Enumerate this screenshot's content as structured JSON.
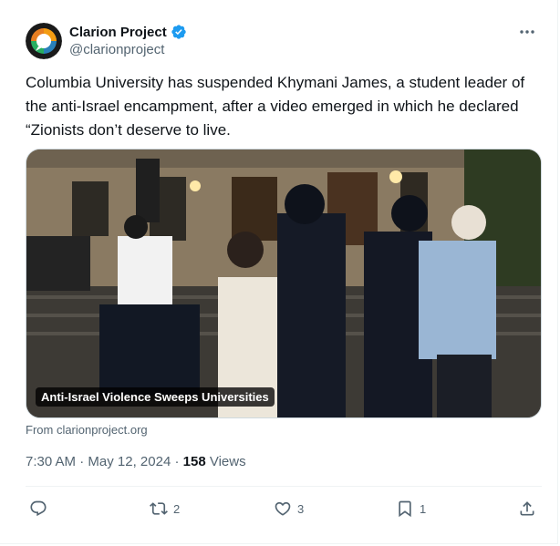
{
  "account": {
    "name": "Clarion Project",
    "handle": "@clarionproject",
    "verified_icon": "verified-badge-icon",
    "brand_color": "#1d9bf0"
  },
  "tweet": {
    "text": "Columbia University has suspended Khymani James, a student leader of the anti-Israel encampment, after a video emerged in which he declared “Zionists don’t deserve to live.",
    "media": {
      "caption": "Anti-Israel Violence Sweeps Universities",
      "source": "From clarionproject.org"
    },
    "time": "7:30 AM",
    "separator": "·",
    "date": "May 12, 2024",
    "views_count": "158",
    "views_label": "Views"
  },
  "actions": {
    "reply": {
      "icon": "reply-icon",
      "count": ""
    },
    "retweet": {
      "icon": "retweet-icon",
      "count": "2"
    },
    "like": {
      "icon": "heart-icon",
      "count": "3"
    },
    "bookmark": {
      "icon": "bookmark-icon",
      "count": "1"
    },
    "share": {
      "icon": "share-icon",
      "count": ""
    }
  }
}
